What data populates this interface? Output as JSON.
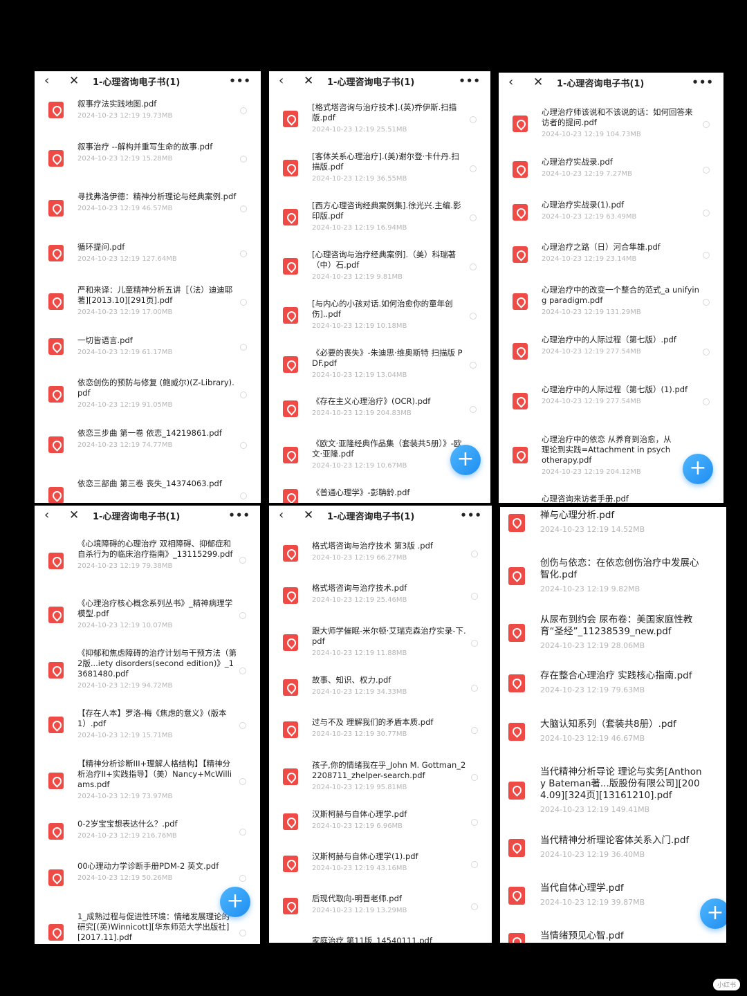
{
  "title": "1-心理咨询电子书(1)",
  "watermark": "小红书",
  "panels": [
    {
      "files": [
        {
          "name": "叙事疗法实践地图.pdf",
          "meta": "2024-10-23  12:19  19.73MB"
        },
        {
          "name": "叙事治疗 --解构并重写生命的故事.pdf",
          "meta": "2024-10-23  12:19  15.28MB"
        },
        {
          "name": "寻找弗洛伊德：精神分析理论与经典案例.pdf",
          "meta": "2024-10-23  12:19  46.57MB"
        },
        {
          "name": "循环提问.pdf",
          "meta": "2024-10-23  12:19  127.64MB"
        },
        {
          "name": "严和来译：儿童精神分析五讲［（法）迪迪耶著][2013.10][291页].pdf",
          "meta": "2024-10-23  12:19  17.00MB"
        },
        {
          "name": "一切皆语言.pdf",
          "meta": "2024-10-23  12:19  61.17MB"
        },
        {
          "name": "依恋创伤的预防与修复 (鲍威尔)(Z-Library).pdf",
          "meta": "2024-10-23  12:19  91.05MB"
        },
        {
          "name": "依恋三步曲 第一卷 依恋_14219861.pdf",
          "meta": "2024-10-23  12:19  74.77MB"
        },
        {
          "name": "依恋三部曲 第三卷 丧失_14374063.pdf",
          "meta": ""
        }
      ]
    },
    {
      "files": [
        {
          "name": "[格式塔咨询与治疗技术].(英)乔伊斯.扫描版.pdf",
          "meta": "2024-10-23  12:19  25.51MB"
        },
        {
          "name": "[客体关系心理治疗].(美)谢尔登·卡什丹.扫描版.pdf",
          "meta": "2024-10-23  12:19  36.55MB"
        },
        {
          "name": "[西方心理咨询经典案例集].徐光兴.主编.影印版.pdf",
          "meta": "2024-10-23  12:19  16.94MB"
        },
        {
          "name": "[心理咨询与治疗经典案例].（美）科瑞著（中）石.pdf",
          "meta": "2024-10-23  12:19  9.81MB"
        },
        {
          "name": "[与内心的小孩对话.如何治愈你的童年创伤]..pdf",
          "meta": "2024-10-23  12:19  10.18MB"
        },
        {
          "name": "《必要的丧失》-朱迪思·维奥斯特 扫描版 PDF.pdf",
          "meta": "2024-10-23  12:19  13.04MB"
        },
        {
          "name": "《存在主义心理治疗》(OCR).pdf",
          "meta": "2024-10-23  12:19  204.83MB"
        },
        {
          "name": "《欧文·亚隆经典作品集（套装共5册）》-欧文·亚隆.pdf",
          "meta": "2024-10-23  12:19  10.67MB"
        },
        {
          "name": "《普通心理学》-彭聃龄.pdf",
          "meta": ""
        }
      ]
    },
    {
      "files": [
        {
          "name": "心理治疗师该说和不该说的话：如何回答来访者的提问.pdf",
          "meta": "2024-10-23  12:19  104.73MB"
        },
        {
          "name": "心理治疗实战录.pdf",
          "meta": "2024-10-23  12:19  7.27MB"
        },
        {
          "name": "心理治疗实战录(1).pdf",
          "meta": "2024-10-23  12:19  63.49MB"
        },
        {
          "name": "心理治疗之路（日）河合隼雄.pdf",
          "meta": "2024-10-23  12:19  23.14MB"
        },
        {
          "name": "心理治疗中的改变一个整合的范式_a unifying paradigm.pdf",
          "meta": "2024-10-23  12:19  131.29MB"
        },
        {
          "name": "心理治疗中的人际过程（第七版）.pdf",
          "meta": "2024-10-23  12:19  277.54MB"
        },
        {
          "name": "心理治疗中的人际过程（第七版）(1).pdf",
          "meta": "2024-10-23  12:19  277.54MB"
        },
        {
          "name": "心理治疗中的依恋 从养育到治愈，从理论到实践=Attachment in psychotherapy.pdf",
          "meta": "2024-10-23  12:19  204.12MB"
        },
        {
          "name": "心理咨询来访者手册.pdf",
          "meta": ""
        }
      ]
    },
    {
      "files": [
        {
          "name": "《心境障碍的心理治疗 双相障碍、抑郁症和自杀行为的临床治疗指南》_13115299.pdf",
          "meta": "2024-10-23  12:19  79.38MB"
        },
        {
          "name": "《心理治疗核心概念系列丛书》_精神病理学模型.pdf",
          "meta": "2024-10-23  12:19  10.07MB"
        },
        {
          "name": "《抑郁和焦虑障碍的治疗计划与干预方法（第2版...iety disorders(second edition)》_13681480.pdf",
          "meta": "2024-10-23  12:19  94.72MB"
        },
        {
          "name": "【存在人本】罗洛-梅《焦虑的意义》(版本1）.pdf",
          "meta": "2024-10-23  12:19  15.71MB"
        },
        {
          "name": "【精神分析诊断III+理解人格结构】【精神分析治疗II+实践指导】（美）Nancy+McWilliams.pdf",
          "meta": "2024-10-23  12:19  73.97MB"
        },
        {
          "name": "0-2岁宝宝想表达什么？.pdf",
          "meta": "2024-10-23  12:19  216.76MB"
        },
        {
          "name": "00心理动力学诊断手册PDM-2 英文.pdf",
          "meta": "2024-10-23  12:19  50.26MB"
        },
        {
          "name": "1_成熟过程与促进性环境：情绪发展理论的研究[(英)Winnicott][华东师范大学出版社][2017.11].pdf",
          "meta": ""
        }
      ]
    },
    {
      "files": [
        {
          "name": "格式塔咨询与治疗技术 第3版 .pdf",
          "meta": "2024-10-23  12:19  66.27MB"
        },
        {
          "name": "格式塔咨询与治疗技术.pdf",
          "meta": "2024-10-23  12:19  25.46MB"
        },
        {
          "name": "跟大师学催眠-米尔顿·艾瑞克森治疗实录-下.pdf",
          "meta": "2024-10-23  12:19  11.88MB"
        },
        {
          "name": "故事、知识、权力.pdf",
          "meta": "2024-10-23  12:19  34.33MB"
        },
        {
          "name": "过与不及 理解我们的矛盾本质.pdf",
          "meta": "2024-10-23  12:19  30.77MB"
        },
        {
          "name": "孩子,你的情绪我在乎_John M. Gottman_22208711_zhelper-search.pdf",
          "meta": "2024-10-23  12:19  95.81MB"
        },
        {
          "name": "汉斯柯赫与自体心理学.pdf",
          "meta": "2024-10-23  12:19  6.96MB"
        },
        {
          "name": "汉斯柯赫与自体心理学(1).pdf",
          "meta": "2024-10-23  12:19  43.16MB"
        },
        {
          "name": "后现代取向-明晋老师.pdf",
          "meta": "2024-10-23  12:19  13.29MB"
        },
        {
          "name": "家庭治疗 第11版_14540111.pdf",
          "meta": ""
        }
      ]
    },
    {
      "files": [
        {
          "name": "禅与心理分析.pdf",
          "meta": "2024-10-23  12:19  14.52MB"
        },
        {
          "name": "创伤与依恋：在依恋创伤治疗中发展心智化.pdf",
          "meta": "2024-10-23  12:19  9.82MB"
        },
        {
          "name": "从尿布到约会 尿布卷：美国家庭性教育“圣经”_11238539_new.pdf",
          "meta": "2024-10-23  12:19  28.06MB"
        },
        {
          "name": "存在整合心理治疗 实践核心指南.pdf",
          "meta": "2024-10-23  12:19  79.63MB"
        },
        {
          "name": "大脑认知系列（套装共8册）.pdf",
          "meta": "2024-10-23  12:19  46.67MB"
        },
        {
          "name": "当代精神分析导论 理论与实务[Anthony Bateman著...版股份有限公司][2004.09][324页][13161210].pdf",
          "meta": "2024-10-23  12:19  149.41MB"
        },
        {
          "name": "当代精神分析理论客体关系入门.pdf",
          "meta": "2024-10-23  12:19  36.40MB"
        },
        {
          "name": "当代自体心理学.pdf",
          "meta": "2024-10-23  12:19  39.87MB"
        },
        {
          "name": "当情绪预见心智.pdf",
          "meta": ""
        }
      ]
    }
  ]
}
